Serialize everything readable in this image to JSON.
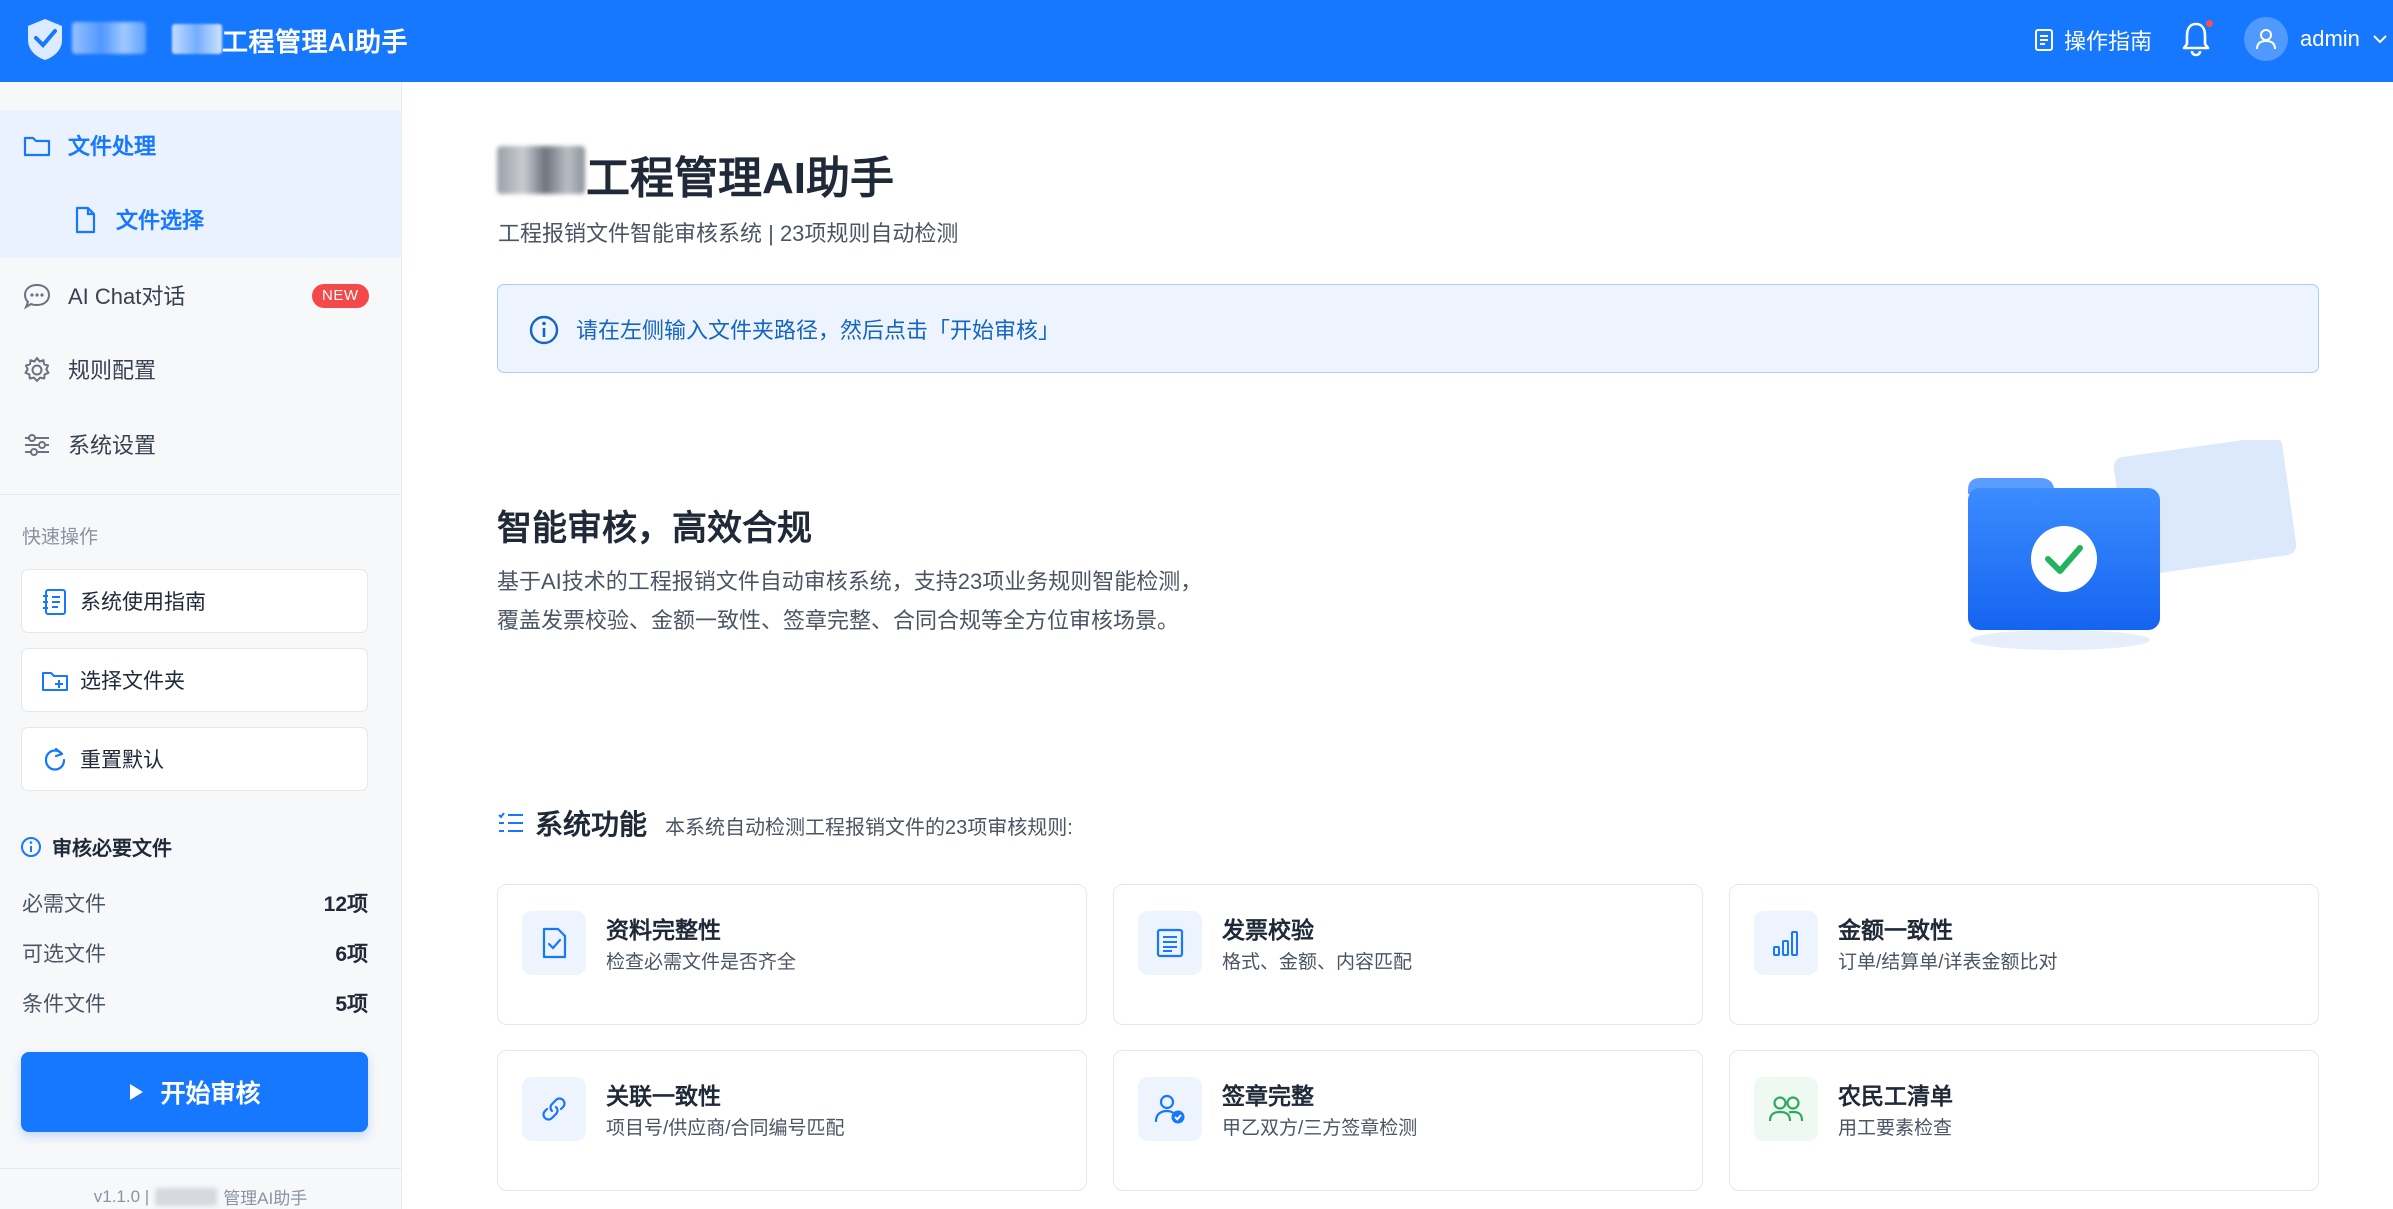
{
  "topbar": {
    "app_title": "工程管理AI助手",
    "guide_label": "操作指南",
    "username": "admin",
    "has_notification": true
  },
  "sidebar": {
    "nav": [
      {
        "label": "文件处理",
        "icon": "folder-icon",
        "state": "expanded"
      },
      {
        "label": "文件选择",
        "icon": "file-icon",
        "state": "selected"
      },
      {
        "label": "AI Chat对话",
        "icon": "chat-icon",
        "badge": "NEW"
      },
      {
        "label": "规则配置",
        "icon": "gear-icon"
      },
      {
        "label": "系统设置",
        "icon": "sliders-icon"
      }
    ],
    "quick_title": "快速操作",
    "quick_actions": [
      {
        "label": "系统使用指南",
        "icon": "guide-icon"
      },
      {
        "label": "选择文件夹",
        "icon": "folder-add-icon"
      },
      {
        "label": "重置默认",
        "icon": "reset-icon"
      }
    ],
    "required": {
      "title": "审核必要文件",
      "rows": [
        {
          "label": "必需文件",
          "value": "12项"
        },
        {
          "label": "可选文件",
          "value": "6项"
        },
        {
          "label": "条件文件",
          "value": "5项"
        }
      ]
    },
    "start_button": "开始审核",
    "version": "v1.1.0 |",
    "version_suffix": "管理AI助手"
  },
  "main": {
    "title": "工程管理AI助手",
    "subtitle": "工程报销文件智能审核系统 | 23项规则自动检测",
    "info": "请在左侧输入文件夹路径，然后点击「开始审核」",
    "feature": {
      "title": "智能审核，高效合规",
      "desc_line1": "基于AI技术的工程报销文件自动审核系统，支持23项业务规则智能检测，",
      "desc_line2": "覆盖发票校验、金额一致性、签章完整、合同合规等全方位审核场景。"
    },
    "functions": {
      "title": "系统功能",
      "desc": "本系统自动检测工程报销文件的23项审核规则:",
      "cards": [
        {
          "title": "资料完整性",
          "desc": "检查必需文件是否齐全",
          "icon": "file-check-icon"
        },
        {
          "title": "发票校验",
          "desc": "格式、金额、内容匹配",
          "icon": "invoice-icon"
        },
        {
          "title": "金额一致性",
          "desc": "订单/结算单/详表金额比对",
          "icon": "bar-chart-icon"
        },
        {
          "title": "关联一致性",
          "desc": "项目号/供应商/合同编号匹配",
          "icon": "link-icon"
        },
        {
          "title": "签章完整",
          "desc": "甲乙双方/三方签章检测",
          "icon": "user-check-icon"
        },
        {
          "title": "农民工清单",
          "desc": "用工要素检查",
          "icon": "users-icon"
        }
      ]
    }
  },
  "colors": {
    "primary": "#1677ff",
    "badge": "#f5484a",
    "info_bg": "#edf4fd",
    "sidebar_bg": "#f7f8fa"
  }
}
